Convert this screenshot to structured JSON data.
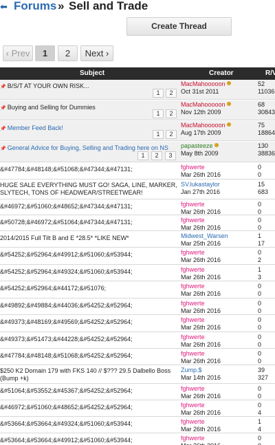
{
  "breadcrumb": {
    "forums": "Forums",
    "separator": "»",
    "current": "Sell and Trade"
  },
  "toolbar": {
    "create_thread": "Create Thread"
  },
  "pager": {
    "prev": "‹ Prev",
    "page1": "1",
    "page2": "2",
    "next": "Next ›"
  },
  "table": {
    "col_subject": "Subject",
    "col_creator": "Creator",
    "col_rv": "R/V"
  },
  "colors": {
    "link": "#2a6ab1",
    "red_user": "#c8102e",
    "pink_user": "#e0197d",
    "green_user": "#2e7d1e",
    "blue_user": "#2a6ab1"
  },
  "sticky": [
    {
      "subject": "B/S/T AT YOUR OWN RISK...",
      "creator": "MacMahooooon",
      "date": "Oct 31st 2011",
      "replies": "52",
      "views": "11036",
      "pages": [
        "1",
        "2"
      ]
    },
    {
      "subject": "Buying and Selling for Dummies",
      "creator": "MacMahooooon",
      "date": "Nov 12th 2009",
      "replies": "68",
      "views": "30843",
      "pages": [
        "1",
        "2"
      ]
    },
    {
      "subject": "Member Feed Back!",
      "creator": "MacMahooooon",
      "date": "Aug 17th 2009",
      "replies": "75",
      "views": "18864",
      "pages": [
        "1",
        "2"
      ]
    },
    {
      "subject": "General Advice for Buying, Selling and Trading here on NS",
      "creator": "papasteeze",
      "date": "May 8th 2009",
      "replies": "130",
      "views": "38836",
      "pages": [
        "1",
        "2",
        "3"
      ]
    }
  ],
  "threads": [
    {
      "subject": "&#47784;&#48148;&#51068;&#47344;&#47131;",
      "creator": "fghwerte",
      "date": "Mar 26th 2016",
      "replies": "0",
      "views": "0"
    },
    {
      "subject": "HUGE SALE EVERYTHING MUST GO! SAGA, LINE, MARKER, SLYTECH, TONS OF HEADWEAR/STREETWEAR!",
      "creator": "SV.lukastaylor",
      "date": "Jan 27th 2016",
      "replies": "15",
      "views": "683"
    },
    {
      "subject": "&#46972;&#51060;&#48652;&#47344;&#47131;",
      "creator": "fghwerte",
      "date": "Mar 26th 2016",
      "replies": "0",
      "views": "0"
    },
    {
      "subject": "&#50728;&#46972;&#51064;&#47344;&#47131;",
      "creator": "fghwerte",
      "date": "Mar 26th 2016",
      "replies": "0",
      "views": "0"
    },
    {
      "subject": "2014/2015 Full Tilt B and E *28.5* *LIKE NEW*",
      "creator": "Midwest_Warsen",
      "date": "Mar 25th 2016",
      "replies": "1",
      "views": "17"
    },
    {
      "subject": "&#54252;&#52964;&#49912;&#51060;&#53944;",
      "creator": "fghwerte",
      "date": "Mar 26th 2016",
      "replies": "0",
      "views": "2"
    },
    {
      "subject": "&#54252;&#52964;&#49324;&#51060;&#53944;",
      "creator": "fghwerte",
      "date": "Mar 26th 2016",
      "replies": "1",
      "views": "3"
    },
    {
      "subject": "&#54252;&#52964;&#44172;&#51076;",
      "creator": "fghwerte",
      "date": "Mar 26th 2016",
      "replies": "0",
      "views": "0"
    },
    {
      "subject": "&#49892;&#49884;&#44036;&#54252;&#52964;",
      "creator": "fghwerte",
      "date": "Mar 26th 2016",
      "replies": "0",
      "views": "0"
    },
    {
      "subject": "&#49373;&#48169;&#49569;&#54252;&#52964;",
      "creator": "fghwerte",
      "date": "Mar 26th 2016",
      "replies": "0",
      "views": "0"
    },
    {
      "subject": "&#49373;&#51473;&#44228;&#54252;&#52964;",
      "creator": "fghwerte",
      "date": "Mar 26th 2016",
      "replies": "0",
      "views": "0"
    },
    {
      "subject": "&#47784;&#48148;&#51068;&#54252;&#52964;",
      "creator": "fghwerte",
      "date": "Mar 26th 2016",
      "replies": "0",
      "views": "0"
    },
    {
      "subject": "$250 K2 Domain 179 with FKS 140 // $??? 29.5 Dalbello Boss (Bump +k)",
      "creator": "Zump.$",
      "date": "Mar 14th 2016",
      "replies": "39",
      "views": "327"
    },
    {
      "subject": "&#51064;&#53552;&#45367;&#54252;&#52964;",
      "creator": "fghwerte",
      "date": "Mar 26th 2016",
      "replies": "0",
      "views": "0"
    },
    {
      "subject": "&#46972;&#51060;&#48652;&#54252;&#52964;",
      "creator": "fghwerte",
      "date": "Mar 26th 2016",
      "replies": "0",
      "views": "4"
    },
    {
      "subject": "&#53664;&#53664;&#49324;&#51060;&#53944;",
      "creator": "fghwerte",
      "date": "Mar 26th 2016",
      "replies": "1",
      "views": "4"
    },
    {
      "subject": "&#53664;&#53664;&#49912;&#51060;&#53944;",
      "creator": "fghwerte",
      "date": "Mar 26th 2016",
      "replies": "0",
      "views": "0"
    }
  ]
}
